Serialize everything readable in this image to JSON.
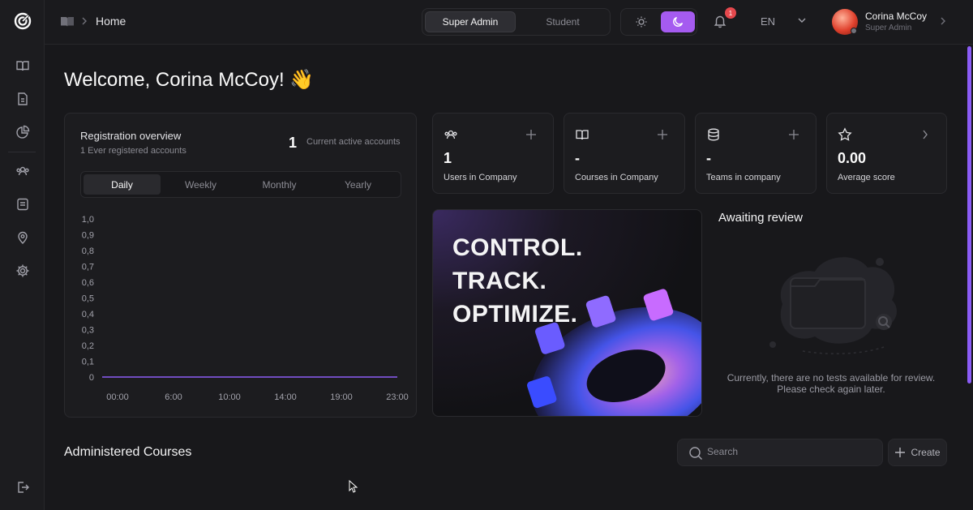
{
  "breadcrumb": {
    "current": "Home"
  },
  "role_switch": {
    "active": "Super Admin",
    "other": "Student"
  },
  "notifications": {
    "count": "1"
  },
  "language": {
    "code": "EN"
  },
  "user": {
    "name": "Corina McCoy",
    "role": "Super Admin"
  },
  "welcome": {
    "text": "Welcome, Corina McCoy! 👋"
  },
  "registration": {
    "title": "Registration overview",
    "subtitle": "1 Ever registered accounts",
    "active_count": "1",
    "active_label": "Current active accounts",
    "tabs": [
      "Daily",
      "Weekly",
      "Monthly",
      "Yearly"
    ],
    "active_tab": "Daily"
  },
  "chart_data": {
    "type": "line",
    "x": [
      "00:00",
      "6:00",
      "10:00",
      "14:00",
      "19:00",
      "23:00"
    ],
    "y_ticks": [
      "1,0",
      "0,9",
      "0,8",
      "0,7",
      "0,6",
      "0,5",
      "0,4",
      "0,3",
      "0,2",
      "0,1",
      "0"
    ],
    "ylim": [
      0,
      1
    ],
    "series": [
      {
        "values": [
          0,
          0,
          0,
          0,
          0,
          0
        ]
      }
    ],
    "color": "#8b5cf6",
    "grid": false
  },
  "stats": [
    {
      "icon": "users-icon",
      "value": "1",
      "label": "Users in Company",
      "action": "plus"
    },
    {
      "icon": "book-icon",
      "value": "-",
      "label": "Courses in Company",
      "action": "plus"
    },
    {
      "icon": "database-icon",
      "value": "-",
      "label": "Teams in company",
      "action": "plus"
    },
    {
      "icon": "star-icon",
      "value": "0.00",
      "label": "Average score",
      "action": "chevron"
    }
  ],
  "banner": {
    "lines": [
      "CONTROL.",
      "TRACK.",
      "OPTIMIZE."
    ]
  },
  "awaiting": {
    "title": "Awaiting review",
    "message": "Currently, there are no tests available for review. Please check again later."
  },
  "courses": {
    "title": "Administered Courses",
    "search_placeholder": "Search",
    "create_label": "Create"
  },
  "colors": {
    "accent": "#a55bf0",
    "badge": "#e5484d",
    "background": "#18181b"
  }
}
